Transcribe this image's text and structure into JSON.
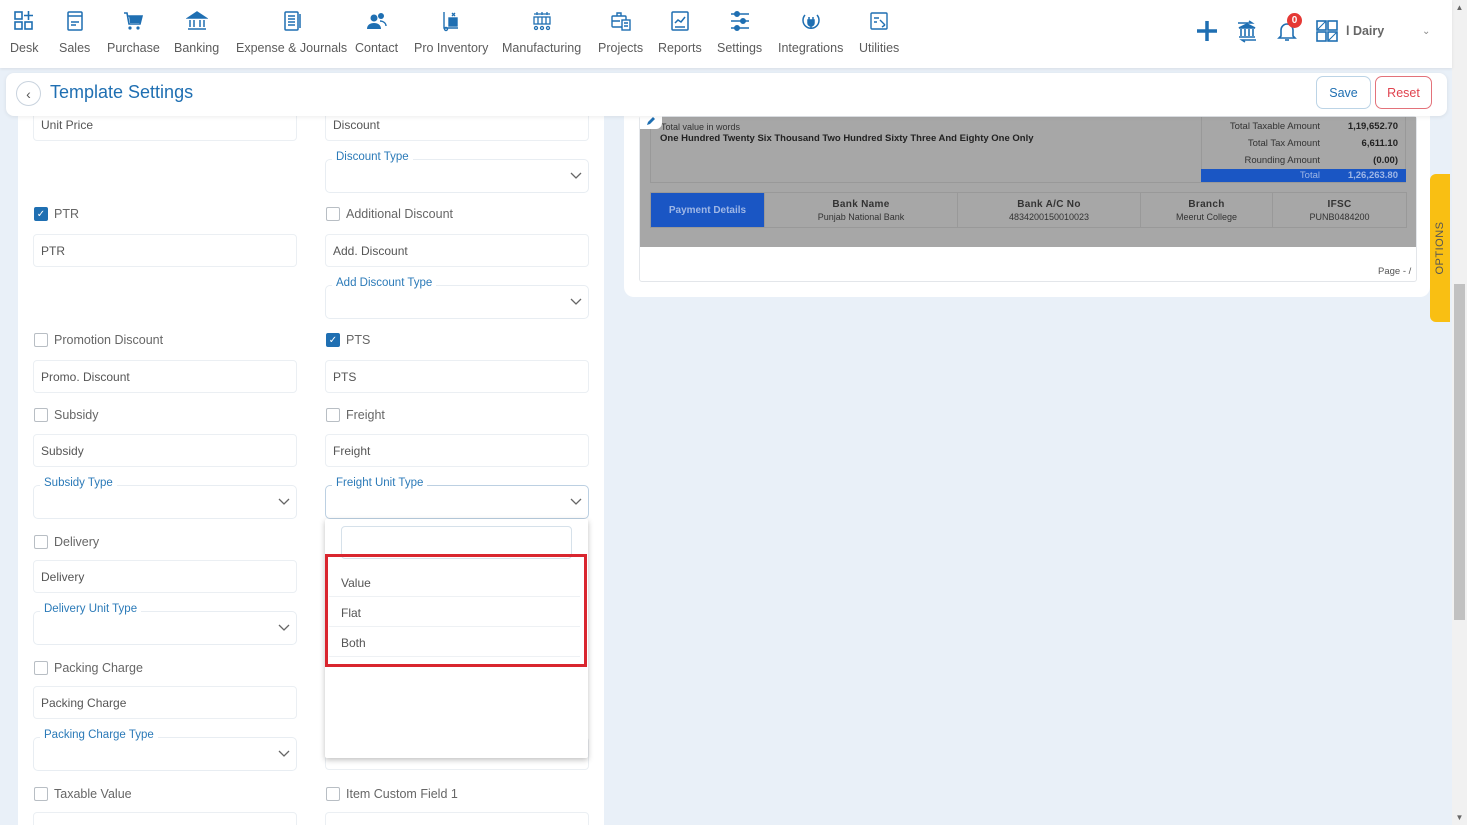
{
  "nav": {
    "items": [
      {
        "label": "Desk",
        "icon": "desk-icon"
      },
      {
        "label": "Sales",
        "icon": "sales-icon"
      },
      {
        "label": "Purchase",
        "icon": "cart-icon"
      },
      {
        "label": "Banking",
        "icon": "bank-icon"
      },
      {
        "label": "Expense & Journals",
        "icon": "journal-icon"
      },
      {
        "label": "Contact",
        "icon": "contact-icon"
      },
      {
        "label": "Pro Inventory",
        "icon": "inventory-icon"
      },
      {
        "label": "Manufacturing",
        "icon": "manufacturing-icon"
      },
      {
        "label": "Projects",
        "icon": "projects-icon"
      },
      {
        "label": "Reports",
        "icon": "reports-icon"
      },
      {
        "label": "Settings",
        "icon": "settings-icon"
      },
      {
        "label": "Integrations",
        "icon": "integrations-icon"
      },
      {
        "label": "Utilities",
        "icon": "utilities-icon"
      }
    ],
    "notification_count": "0",
    "company_name": "l Dairy"
  },
  "header": {
    "title": "Template Settings",
    "save_label": "Save",
    "reset_label": "Reset"
  },
  "settings": {
    "unit_price_value": "Unit Price",
    "discount_value": "Discount",
    "discount_type_label": "Discount Type",
    "ptr": {
      "label": "PTR",
      "checked": true,
      "value": "PTR"
    },
    "additional_discount": {
      "label": "Additional Discount",
      "checked": false,
      "value": "Add. Discount"
    },
    "add_discount_type_label": "Add Discount Type",
    "promotion_discount": {
      "label": "Promotion Discount",
      "checked": false,
      "value": "Promo. Discount"
    },
    "pts": {
      "label": "PTS",
      "checked": true,
      "value": "PTS"
    },
    "subsidy": {
      "label": "Subsidy",
      "checked": false,
      "value": "Subsidy"
    },
    "freight": {
      "label": "Freight",
      "checked": false,
      "value": "Freight"
    },
    "subsidy_type_label": "Subsidy Type",
    "freight_unit_type_label": "Freight Unit Type",
    "delivery": {
      "label": "Delivery",
      "checked": false,
      "value": "Delivery"
    },
    "delivery_unit_type_label": "Delivery Unit Type",
    "packing_charge": {
      "label": "Packing Charge",
      "checked": false,
      "value": "Packing Charge"
    },
    "packing_charge_type_label": "Packing Charge Type",
    "taxable_value": {
      "label": "Taxable Value",
      "checked": false
    },
    "item_custom_field_1": {
      "label": "Item Custom Field 1",
      "checked": false
    }
  },
  "dropdown": {
    "search_value": "",
    "options": [
      "Value",
      "Flat",
      "Both"
    ],
    "highlight_color": "#d9262f"
  },
  "preview": {
    "words_label": "Total value in words",
    "words_value": "One Hundred Twenty Six Thousand Two Hundred Sixty Three And Eighty One Only",
    "totals": [
      {
        "label": "Total Taxable Amount",
        "value": "1,19,652.70"
      },
      {
        "label": "Total Tax Amount",
        "value": "6,611.10"
      },
      {
        "label": "Rounding Amount",
        "value": "(0.00)"
      },
      {
        "label": "Total",
        "value": "1,26,263.80"
      }
    ],
    "payment": {
      "heading": "Payment Details",
      "columns": [
        {
          "header": "Bank Name",
          "value": "Punjab National Bank"
        },
        {
          "header": "Bank A/C No",
          "value": "4834200150010023"
        },
        {
          "header": "Branch",
          "value": "Meerut College"
        },
        {
          "header": "IFSC",
          "value": "PUNB0484200"
        }
      ]
    },
    "page_footer": "Page - /"
  },
  "options_tab_label": "OPTIONS",
  "colors": {
    "brand_blue": "#1f6fb2",
    "invoice_blue": "#1a56c4",
    "reset_red": "#e0434f",
    "options_yellow": "#f9bf13"
  }
}
